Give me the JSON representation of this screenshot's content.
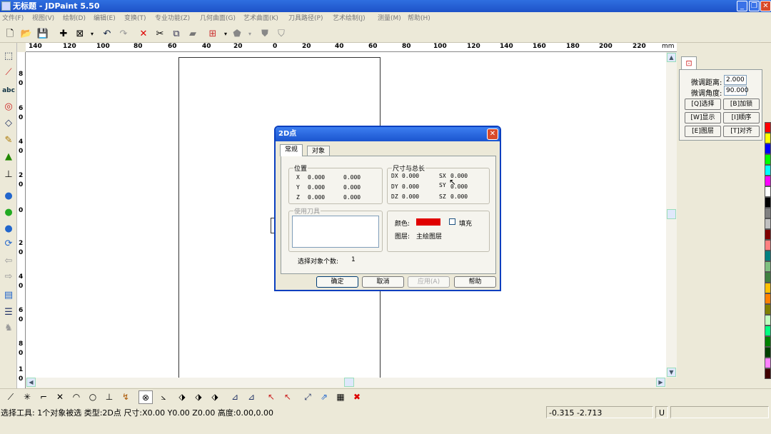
{
  "window": {
    "title": "无标题 - JDPaint 5.50"
  },
  "menu": [
    "文件(F)",
    "视图(V)",
    "绘制(D)",
    "编辑(E)",
    "变换(T)",
    "专业功能(Z)",
    "几何曲面(G)",
    "艺术曲面(K)",
    "刀具路径(P)",
    "艺术绘制(J)",
    "测量(M)",
    "帮助(H)"
  ],
  "hruler": {
    "labels": [
      "140",
      "120",
      "100",
      "80",
      "60",
      "40",
      "20",
      "0",
      "20",
      "40",
      "60",
      "80",
      "100",
      "120",
      "140",
      "160",
      "180",
      "200",
      "220"
    ],
    "unit": "mm"
  },
  "vruler": {
    "labels": [
      "8",
      "0",
      "6",
      "0",
      "4",
      "0",
      "2",
      "0",
      "0",
      "2",
      "0",
      "4",
      "0",
      "6",
      "0",
      "8",
      "0",
      "1",
      "0"
    ]
  },
  "right_panel": {
    "fine_dist_label": "微调距离:",
    "fine_dist_value": "2.000",
    "fine_angle_label": "微调角度:",
    "fine_angle_value": "90.000",
    "buttons": [
      "[Q]选择",
      "[B]加锁",
      "[W]显示",
      "[I]顺序",
      "[E]图层",
      "[T]对齐"
    ]
  },
  "palette": [
    "#ff0000",
    "#ffff00",
    "#0000ff",
    "#00ff00",
    "#00ffff",
    "#ff00ff",
    "#ffffff",
    "#000000",
    "#808080",
    "#c0c0c0",
    "#800000",
    "#ff8080",
    "#008080",
    "#80c080",
    "#408040",
    "#ffc000",
    "#ff8000",
    "#808000",
    "#c0ffc0",
    "#00ff80",
    "#008000",
    "#004000",
    "#ff80ff",
    "#400000"
  ],
  "status": {
    "text": "选择工具: 1个对象被选 类型:2D点 尺寸:X0.00 Y0.00 Z0.00 高度:0.00,0.00",
    "coords": "-0.315 -2.713",
    "mode": "U"
  },
  "dialog": {
    "title": "2D点",
    "close": "✕",
    "tabs": [
      "常规",
      "对象"
    ],
    "position": {
      "title": "位置",
      "rows": [
        {
          "axis": "X",
          "a": "0.000",
          "b": "0.000"
        },
        {
          "axis": "Y",
          "a": "0.000",
          "b": "0.000"
        },
        {
          "axis": "Z",
          "a": "0.000",
          "b": "0.000"
        }
      ]
    },
    "size": {
      "title": "尺寸与总长",
      "rows": [
        {
          "l1": "DX",
          "v1": "0.000",
          "l2": "SX",
          "v2": "0.000"
        },
        {
          "l1": "DY",
          "v1": "0.000",
          "l2": "SY",
          "v2": "0.000"
        },
        {
          "l1": "DZ",
          "v1": "0.000",
          "l2": "SZ",
          "v2": "0.000"
        }
      ]
    },
    "tool": {
      "title": "使用刀具"
    },
    "color_label": "颜色:",
    "fill_label": "填充",
    "layer_label": "图层:",
    "layer_value": "主绘图层",
    "color": "#e00000",
    "count_label": "选择对象个数:",
    "count_value": "1",
    "buttons": {
      "ok": "确定",
      "cancel": "取消",
      "apply": "应用(A)",
      "help": "帮助"
    }
  }
}
